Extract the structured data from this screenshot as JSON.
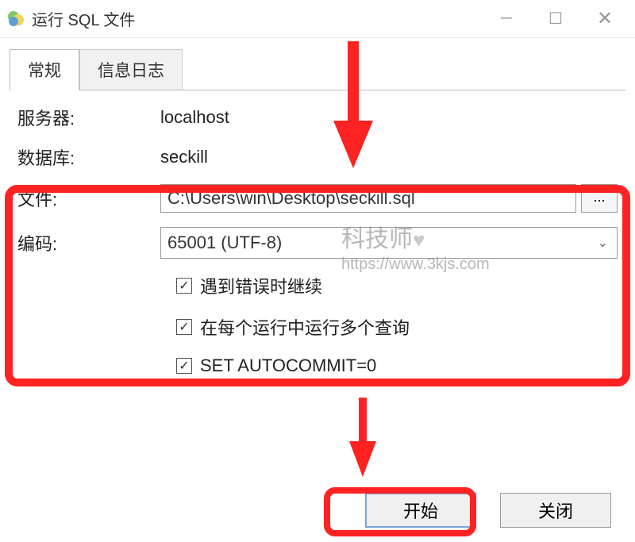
{
  "window": {
    "title": "运行 SQL 文件"
  },
  "tabs": {
    "general": "常规",
    "log": "信息日志"
  },
  "labels": {
    "server": "服务器:",
    "database": "数据库:",
    "file": "文件:",
    "encoding": "编码:"
  },
  "values": {
    "server": "localhost",
    "database": "seckill",
    "file": "C:\\Users\\win\\Desktop\\seckill.sql",
    "encoding": "65001 (UTF-8)"
  },
  "checkboxes": {
    "continueOnError": "遇到错误时继续",
    "multiQuery": "在每个运行中运行多个查询",
    "autocommit": "SET AUTOCOMMIT=0"
  },
  "buttons": {
    "browse": "...",
    "start": "开始",
    "close": "关闭"
  },
  "watermark": {
    "line1": "科技师",
    "line2": "https://www.3kjs.com"
  }
}
